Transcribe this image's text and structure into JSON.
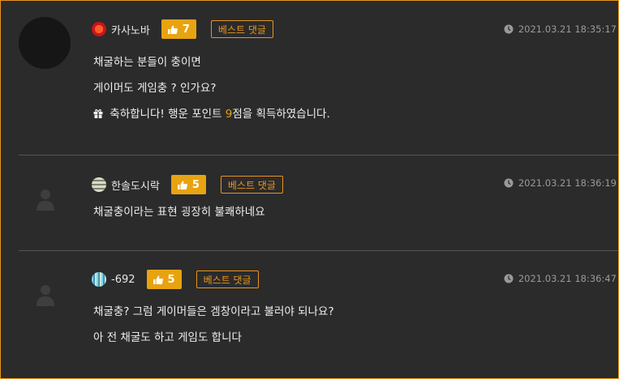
{
  "comments": [
    {
      "username": "카사노바",
      "likes": "7",
      "badge": "베스트 댓글",
      "date": "2021.03.21 18:35:17",
      "lines": [
        "채굴하는 분들이 충이면",
        "게이머도 게임충 ? 인가요?"
      ],
      "reward": {
        "prefix": "축하합니다! 행운 포인트 ",
        "points": "9",
        "suffix": "점을 획득하였습니다."
      }
    },
    {
      "username": "한솔도시락",
      "likes": "5",
      "badge": "베스트 댓글",
      "date": "2021.03.21 18:36:19",
      "lines": [
        "채굴충이라는 표현  굉장히 불쾌하네요"
      ]
    },
    {
      "username": "-692",
      "likes": "5",
      "badge": "베스트 댓글",
      "date": "2021.03.21 18:36:47",
      "lines": [
        "채굴충? 그럼 게이머들은 겜창이라고 불러야 되나요?",
        "아 전 채굴도 하고 게임도 합니다"
      ]
    }
  ],
  "colors": {
    "accent": "#e8a311",
    "border": "#e8951e",
    "background": "#2b2b2b"
  },
  "icons": [
    "level-badge-icon",
    "thumbs-up-icon",
    "clock-icon",
    "gift-icon",
    "user-avatar-icon"
  ]
}
